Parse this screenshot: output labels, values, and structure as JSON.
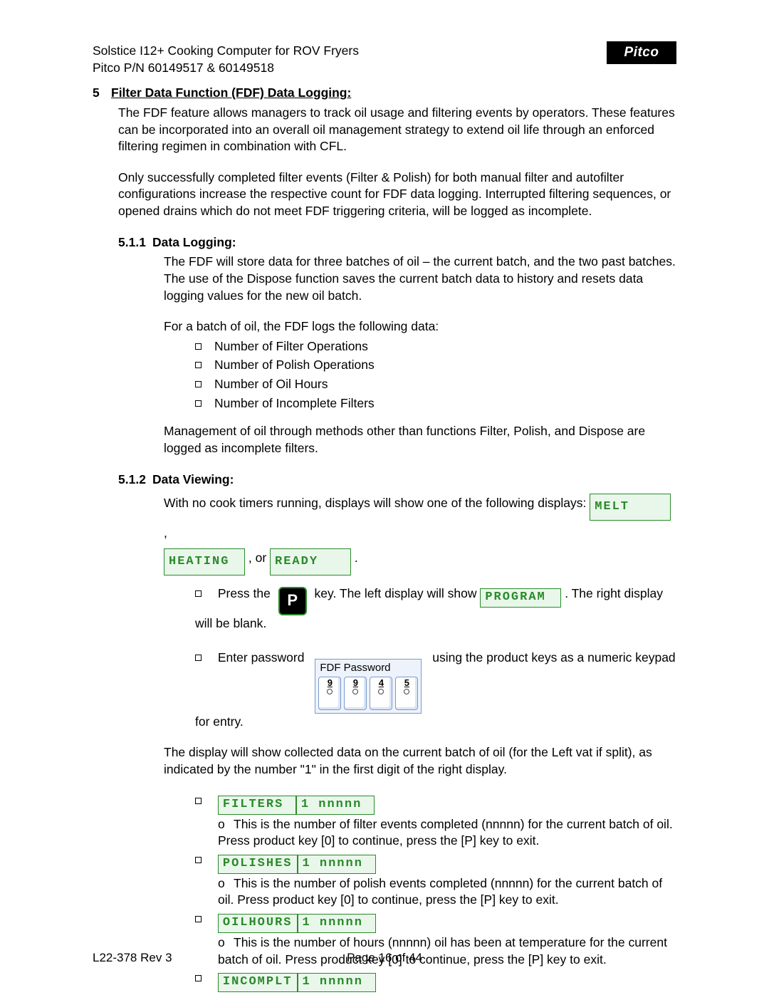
{
  "header": {
    "line1": "Solstice I12+ Cooking Computer for ROV Fryers",
    "line2": "Pitco P/N 60149517 & 60149518",
    "logo_text": "Pitco"
  },
  "section": {
    "number": "5",
    "title": "Filter Data Function (FDF) Data Logging:",
    "para1": "The FDF feature allows managers to track oil usage and filtering events by operators.  These features can be incorporated into an overall oil management strategy to extend oil life through an enforced filtering regimen in combination with CFL.",
    "para2": "Only successfully completed filter events (Filter & Polish) for both manual filter and autofilter configurations increase the respective count for FDF data logging.  Interrupted filtering sequences, or opened drains which do not meet FDF triggering criteria, will be logged as incomplete."
  },
  "sub1": {
    "number": "5.1.1",
    "title": "Data Logging:",
    "p1": "The FDF will store data for three batches of oil – the current batch, and the two past batches.  The use of the Dispose function saves the current batch data to history and resets data logging values for the new oil batch.",
    "p2": "For a batch of oil, the FDF logs the following data:",
    "items": [
      "Number of Filter Operations",
      "Number of Polish Operations",
      "Number of Oil Hours",
      "Number of Incomplete Filters"
    ],
    "p3": "Management of oil through methods other than functions Filter, Polish, and Dispose are logged as incomplete filters."
  },
  "sub2": {
    "number": "5.1.2",
    "title": "Data Viewing:",
    "intro_a": "With no cook timers running, displays will show one of the following displays:  ",
    "lcd_melt": "MELT",
    "intro_b": ", ",
    "lcd_heating": "HEATING",
    "intro_c": ", or ",
    "lcd_ready": "READY",
    "intro_d": ".",
    "step1_a": "Press the ",
    "p_key_label": "P",
    "step1_b": " key.  The left display will show ",
    "lcd_program": "PROGRAM",
    "step1_c": ".  The right display will be blank.",
    "step2_a": "Enter password",
    "pw_caption": "FDF Password",
    "pw_digits": [
      "9",
      "9",
      "4",
      "5"
    ],
    "step2_b": "using the product keys as a numeric keypad for entry.",
    "result_intro": "The display will show collected data on the current batch of oil (for the Left vat if split), as indicated by the number \"1\" in the first digit of the right display.",
    "data_items": [
      {
        "lcd_left": "FILTERS",
        "lcd_right": "1   nnnnn",
        "desc": "This is the number of filter events completed (nnnnn) for the current batch of oil.  Press product key [0] to continue, press the [P] key to exit."
      },
      {
        "lcd_left": "POLISHES",
        "lcd_right": "1    nnnnn",
        "desc": "This is the number of polish events completed (nnnnn) for the current batch of oil.  Press product key [0] to continue, press the [P] key to exit."
      },
      {
        "lcd_left": "OILHOURS",
        "lcd_right": "1   nnnnn",
        "desc": "This is the number of hours (nnnnn) oil has been at temperature for the current batch of oil.  Press product key [0] to continue, press the [P] key to exit."
      },
      {
        "lcd_left": "INCOMPLT",
        "lcd_right": "1   nnnnn",
        "desc": ""
      }
    ]
  },
  "footer": {
    "left": "L22-378 Rev 3",
    "center": "Page 16 of 44"
  }
}
